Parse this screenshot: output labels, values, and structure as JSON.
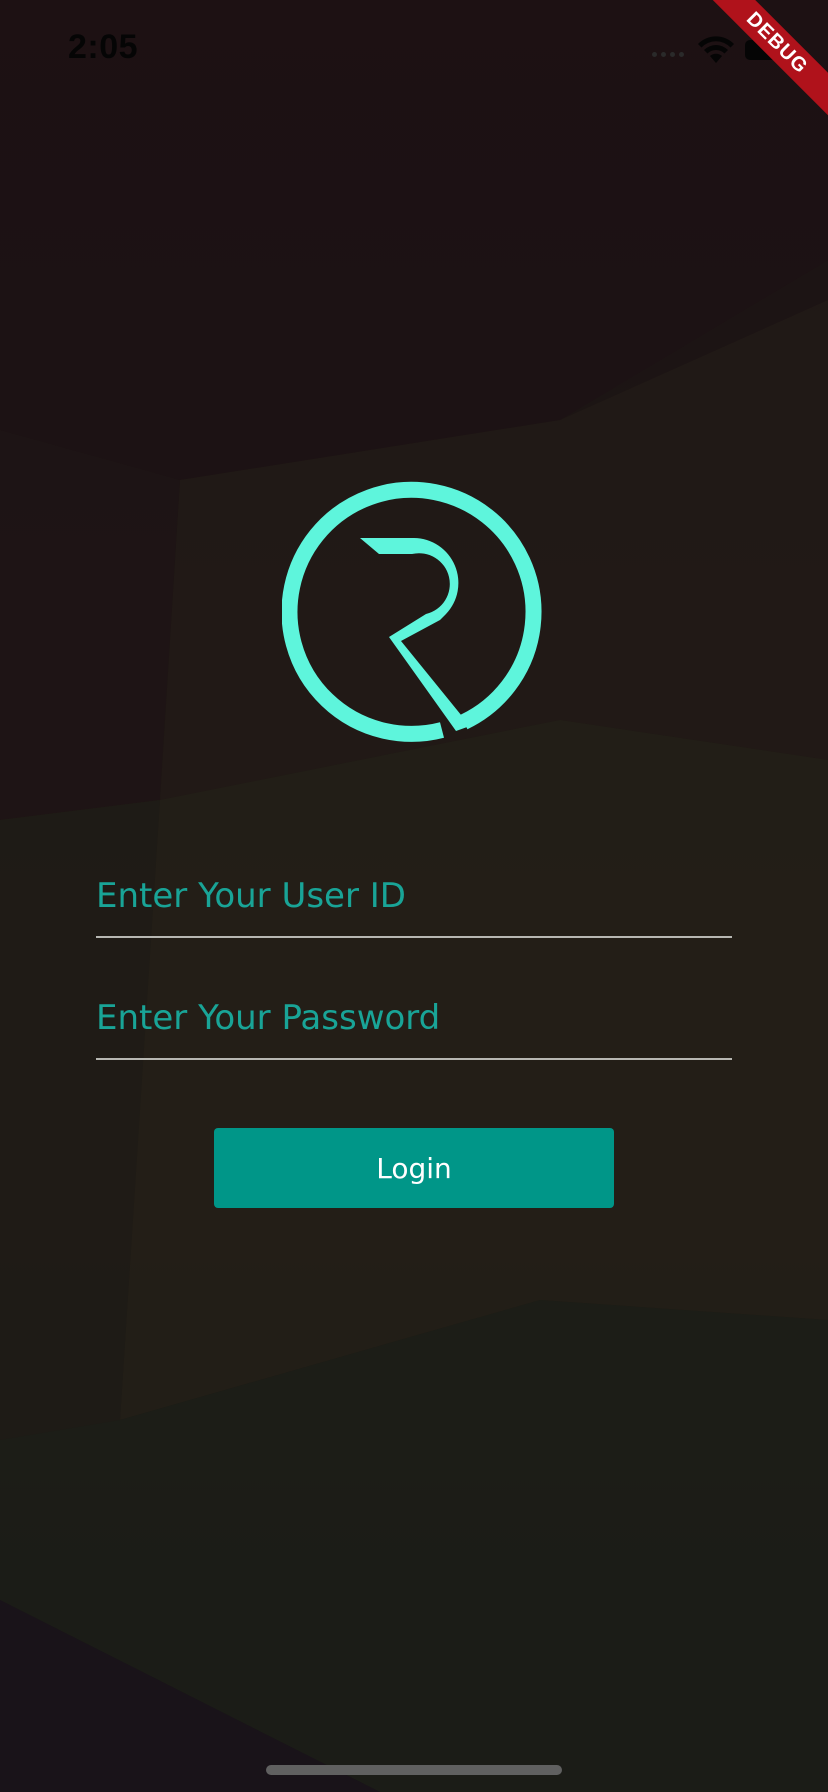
{
  "status_bar": {
    "time": "2:05"
  },
  "debug_banner": {
    "label": "DEBUG"
  },
  "form": {
    "user_id_placeholder": "Enter Your User ID",
    "password_placeholder": "Enter Your Password",
    "login_label": "Login"
  },
  "icons": {
    "logo": "r-circle-logo",
    "wifi": "wifi-icon",
    "battery": "battery-icon",
    "signal": "cellular-signal-icon"
  },
  "colors": {
    "accent": "#009688",
    "logo": "#5ef5dc",
    "placeholder": "#19a497",
    "debug_ribbon": "#b0121b"
  }
}
